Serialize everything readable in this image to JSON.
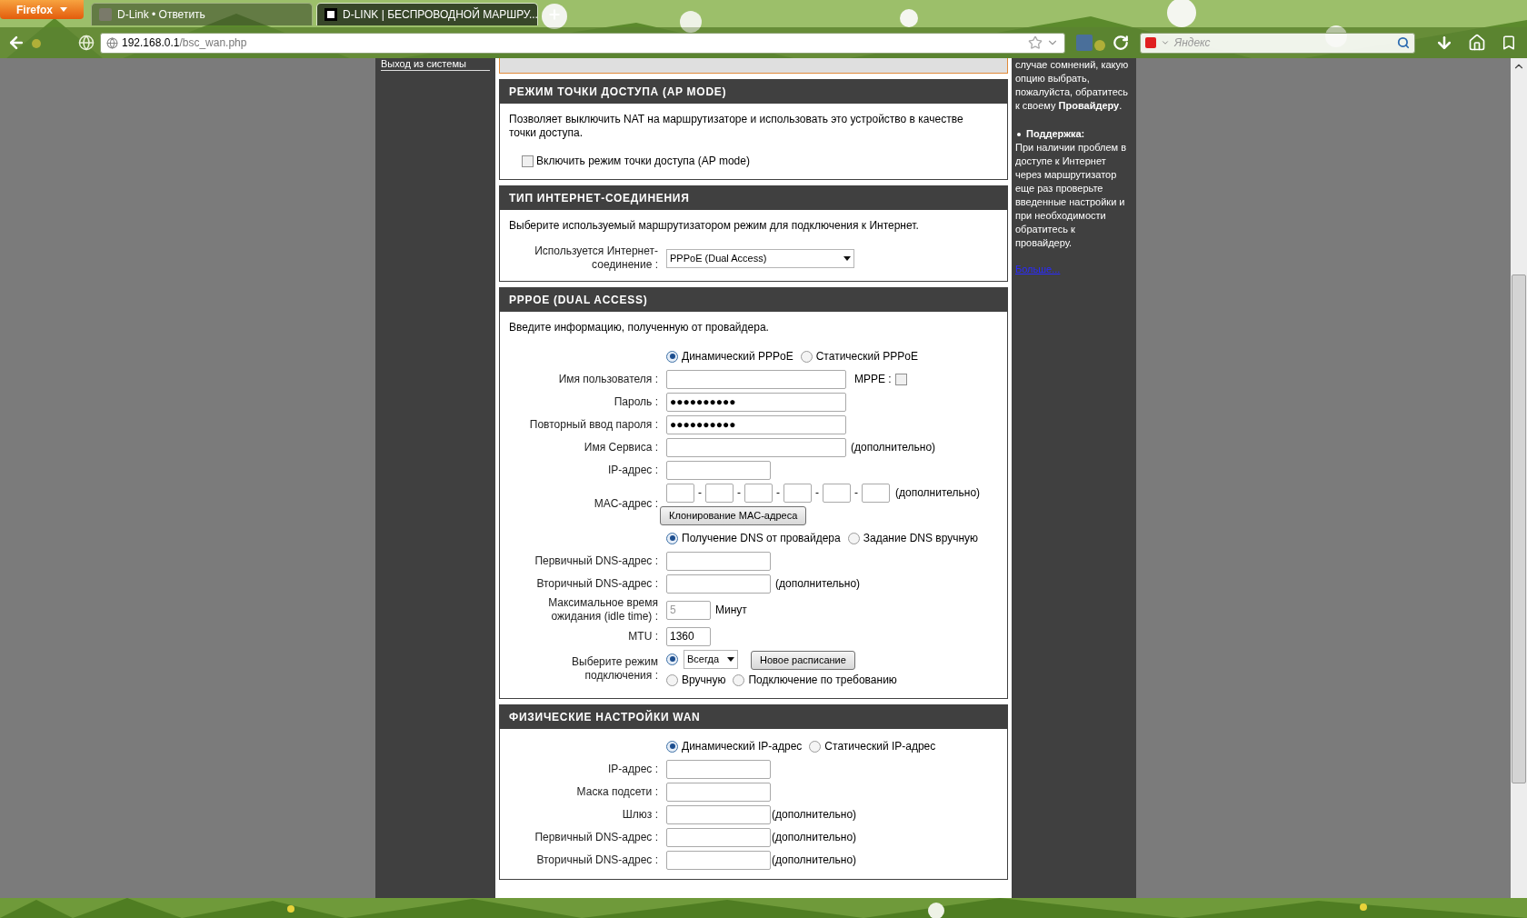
{
  "browser": {
    "menu_button": "Firefox",
    "tabs": [
      {
        "title": "D-Link • Ответить",
        "selected": false
      },
      {
        "title": "D-LINK | БЕСПРОВОДНОЙ МАРШРУ...",
        "selected": true
      }
    ],
    "url_host": "192.168.0.1",
    "url_path": "/bsc_wan.php",
    "search_placeholder": "Яндекс"
  },
  "left_nav": {
    "items": [
      {
        "label": "Выход из системы"
      }
    ]
  },
  "sections": [
    {
      "title": "РЕЖИМ ТОЧКИ ДОСТУПА (AP MODE)",
      "description": "Позволяет выключить NAT на маршрутизаторе и использовать это устройство в качестве точки доступа.",
      "rows": [
        {
          "kind": "checkbox",
          "label": "Включить режим точки доступа (AP mode)",
          "checked": false
        }
      ]
    },
    {
      "title": "ТИП ИНТЕРНЕТ-СОЕДИНЕНИЯ",
      "description": "Выберите используемый маршрутизатором режим для подключения к Интернет.",
      "rows": [
        {
          "kind": "select",
          "label": "Используется Интернет-соединение :",
          "value": "PPPoE (Dual Access)"
        }
      ]
    },
    {
      "title": "PPPOE (DUAL ACCESS)",
      "description": "Введите информацию, полученную от провайдера.",
      "rows": [
        {
          "kind": "radios",
          "options": [
            {
              "label": "Динамический PPPoE",
              "selected": true
            },
            {
              "label": "Статический PPPoE",
              "selected": false
            }
          ]
        },
        {
          "kind": "wide_input",
          "label": "Имя пользователя :",
          "addon": {
            "label": "MPPE :",
            "checked": false
          }
        },
        {
          "kind": "wide_input",
          "label": "Пароль :",
          "value": "●●●●●●●●●●"
        },
        {
          "kind": "wide_input",
          "label": "Повторный ввод пароля :",
          "value": "●●●●●●●●●●"
        },
        {
          "kind": "wide_input",
          "label": "Имя Сервиса :",
          "note": "(дополнительно)"
        },
        {
          "kind": "input",
          "label": "IP-адрес :"
        },
        {
          "kind": "mac",
          "label": "MAC-адрес :",
          "separator": "-",
          "note": "(дополнительно)",
          "button": "Клонирование MAC-адреса"
        },
        {
          "kind": "radios",
          "options": [
            {
              "label": "Получение DNS от провайдера",
              "selected": true
            },
            {
              "label": "Задание DNS вручную",
              "selected": false
            }
          ]
        },
        {
          "kind": "input",
          "label": "Первичный DNS-адрес :"
        },
        {
          "kind": "input",
          "label": "Вторичный DNS-адрес :",
          "note": "(дополнительно)"
        },
        {
          "kind": "short_input",
          "label": "Максимальное время ожидания (idle time) :",
          "value": "5",
          "disabled": true,
          "note": "Минут"
        },
        {
          "kind": "short_input",
          "label": "MTU :",
          "value": "1360",
          "disabled": false
        },
        {
          "kind": "connect_mode",
          "label": "Выберите режим подключения :",
          "options": [
            {
              "kind": "select",
              "value": "Всегда",
              "button": "Новое расписание",
              "selected": true
            },
            {
              "kind": "radio",
              "label": "Вручную",
              "selected": false
            },
            {
              "kind": "radio",
              "label": "Подключение по требованию",
              "selected": false
            }
          ]
        }
      ]
    },
    {
      "title": "ФИЗИЧЕСКИЕ НАСТРОЙКИ WAN",
      "rows": [
        {
          "kind": "radios",
          "options": [
            {
              "label": "Динамический IP-адрес",
              "selected": true
            },
            {
              "label": "Статический IP-адрес",
              "selected": false
            }
          ]
        },
        {
          "kind": "input",
          "label": "IP-адрес :"
        },
        {
          "kind": "input",
          "label": "Маска подсети :"
        },
        {
          "kind": "input",
          "label": "Шлюз :",
          "note": "(дополнительно)"
        },
        {
          "kind": "input",
          "label": "Первичный DNS-адрес :",
          "note": "(дополнительно)"
        },
        {
          "kind": "input",
          "label": "Вторичный DNS-адрес :",
          "note": "(дополнительно)"
        }
      ]
    }
  ],
  "help": {
    "intro": "случае сомнений, какую опцию выбрать, пожалуйста, обратитесь к своему **Провайдеру**.",
    "heading": "Поддержка:",
    "text": "При наличии проблем в доступе к Интернет через маршрутизатор еще раз проверьте введенные настройки и при необходимости обратитесь к провайдеру.",
    "link": "Больше..."
  }
}
